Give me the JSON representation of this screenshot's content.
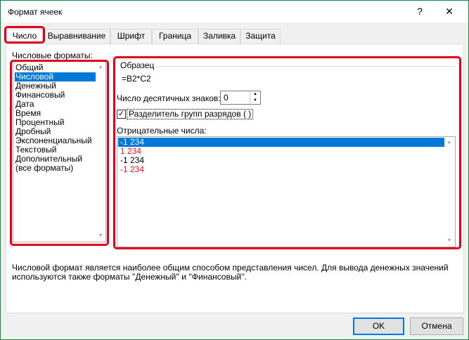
{
  "window": {
    "title": "Формат ячеек",
    "help_label": "?",
    "close_label": "✕"
  },
  "tabs": [
    {
      "label": "Число",
      "active": true
    },
    {
      "label": "Выравнивание",
      "active": false
    },
    {
      "label": "Шрифт",
      "active": false
    },
    {
      "label": "Граница",
      "active": false
    },
    {
      "label": "Заливка",
      "active": false
    },
    {
      "label": "Защита",
      "active": false
    }
  ],
  "categories": {
    "label": "Числовые форматы:",
    "items": [
      "Общий",
      "Числовой",
      "Денежный",
      "Финансовый",
      "Дата",
      "Время",
      "Процентный",
      "Дробный",
      "Экспоненциальный",
      "Текстовый",
      "Дополнительный",
      "(все форматы)"
    ],
    "selected_index": 1
  },
  "sample": {
    "legend": "Образец",
    "value": "=B2*C2"
  },
  "decimals": {
    "label": "Число десятичных знаков:",
    "value": "0"
  },
  "separator": {
    "label": "Разделитель групп разрядов ( )",
    "checked": true,
    "check_glyph": "✓"
  },
  "negative": {
    "label": "Отрицательные числа:",
    "items": [
      {
        "text": "-1 234",
        "color": "#000000"
      },
      {
        "text": "1 234",
        "color": "#e81123"
      },
      {
        "text": "-1 234",
        "color": "#000000"
      },
      {
        "text": "-1 234",
        "color": "#e81123"
      }
    ],
    "selected_index": 0
  },
  "description": "Числовой формат является наиболее общим способом представления чисел. Для вывода денежных значений используются также форматы ''Денежный'' и ''Финансовый''.",
  "buttons": {
    "ok": "OK",
    "cancel": "Отмена"
  },
  "icons": {
    "scroll_up": "▲",
    "scroll_down": "▼"
  },
  "colors": {
    "highlight": "#e0001b",
    "selection": "#0078d7"
  }
}
